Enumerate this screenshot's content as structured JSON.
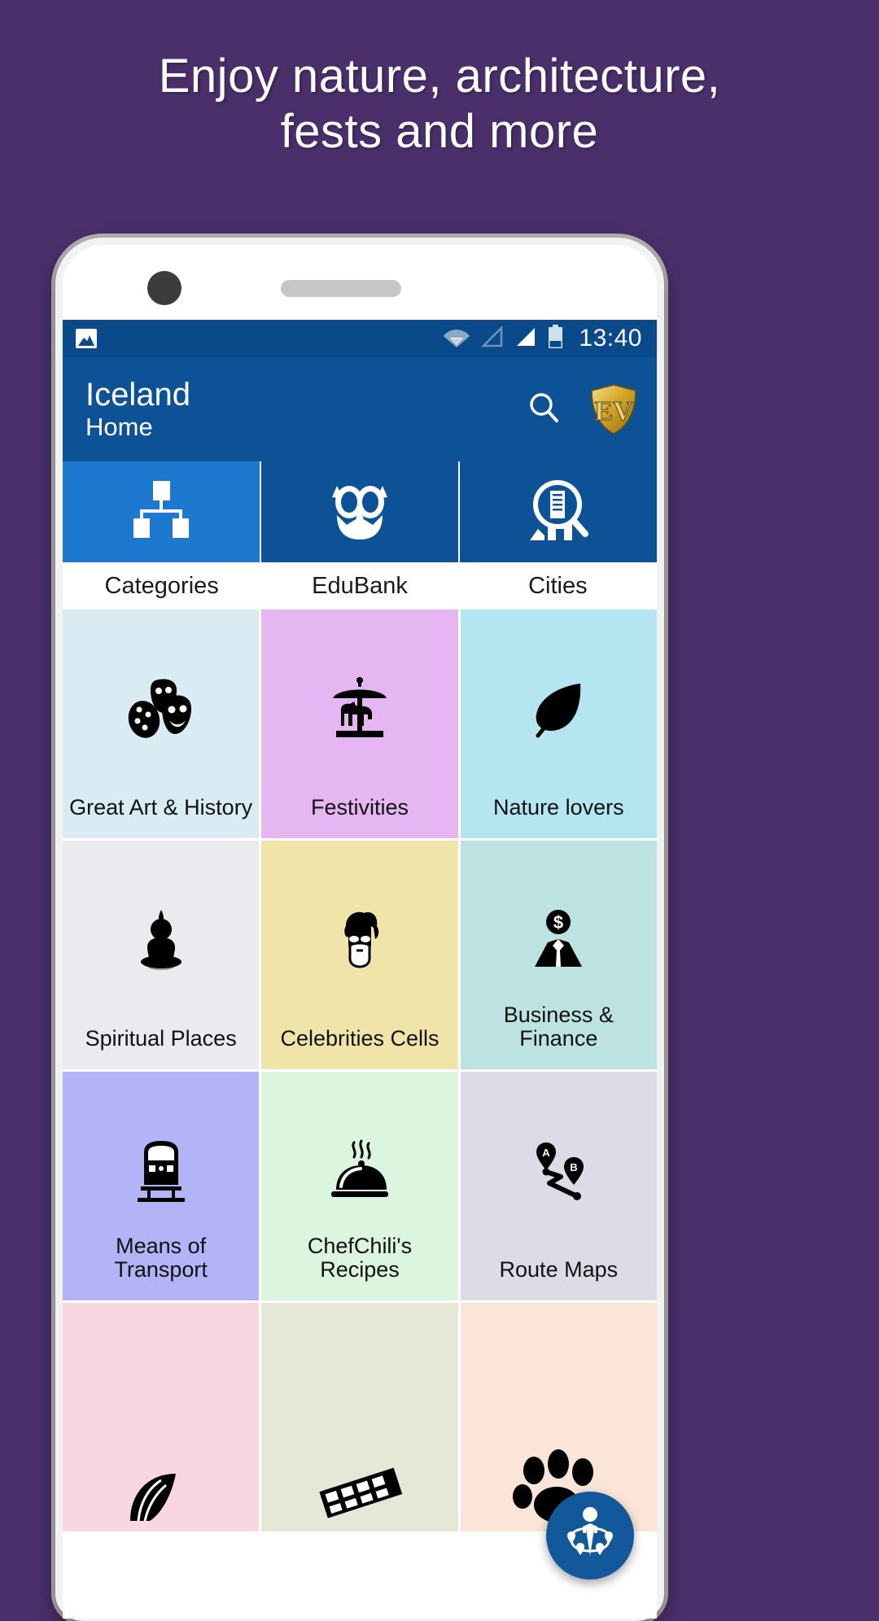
{
  "promo": {
    "line1": "Enjoy nature, architecture,",
    "line2": "fests and more"
  },
  "colors": {
    "background": "#4b2f6b",
    "appbar": "#0d5296",
    "statusbar": "#0a4a8a",
    "tab_active": "#1d78d0",
    "fab": "#14589c",
    "logo_gold": "#d8a72b"
  },
  "statusbar": {
    "time": "13:40",
    "icons": [
      "photo-icon",
      "wifi-icon",
      "signal-empty-icon",
      "signal-full-icon",
      "battery-icon"
    ]
  },
  "appbar": {
    "title": "Iceland",
    "subtitle": "Home",
    "search_icon": "search-icon",
    "logo_text": "EV",
    "logo_icon": "ev-shield-logo"
  },
  "tabs": [
    {
      "label": "Categories",
      "icon": "hierarchy-icon",
      "active": true
    },
    {
      "label": "EduBank",
      "icon": "owl-icon",
      "active": false
    },
    {
      "label": "Cities",
      "icon": "city-search-icon",
      "active": false
    }
  ],
  "grid": {
    "tiles": [
      {
        "label": "Great Art & History",
        "icon": "theater-masks-icon",
        "bg": "#d9ecf4"
      },
      {
        "label": "Festivities",
        "icon": "carousel-icon",
        "bg": "#e5b6f2"
      },
      {
        "label": "Nature lovers",
        "icon": "leaf-icon",
        "bg": "#b3e6f0"
      },
      {
        "label": "Spiritual Places",
        "icon": "buddha-icon",
        "bg": "#ebebef"
      },
      {
        "label": "Celebrities Cells",
        "icon": "celebrity-face-icon",
        "bg": "#f1e4a8"
      },
      {
        "label": "Business & Finance",
        "icon": "businessman-icon",
        "bg": "#bde2e2"
      },
      {
        "label": "Means of Transport",
        "icon": "train-icon",
        "bg": "#b3b3f7"
      },
      {
        "label": "ChefChili's Recipes",
        "icon": "food-cloche-icon",
        "bg": "#dcf5df"
      },
      {
        "label": "Route Maps",
        "icon": "route-ab-icon",
        "bg": "#dcdce8"
      },
      {
        "label": "",
        "icon": "shell-fan-icon",
        "bg": "#f8d7e0"
      },
      {
        "label": "",
        "icon": "film-strip-icon",
        "bg": "#e6e7d6"
      },
      {
        "label": "",
        "icon": "paw-print-icon",
        "bg": "#fae5d8"
      }
    ]
  },
  "fab": {
    "icon": "nearby-people-icon"
  }
}
